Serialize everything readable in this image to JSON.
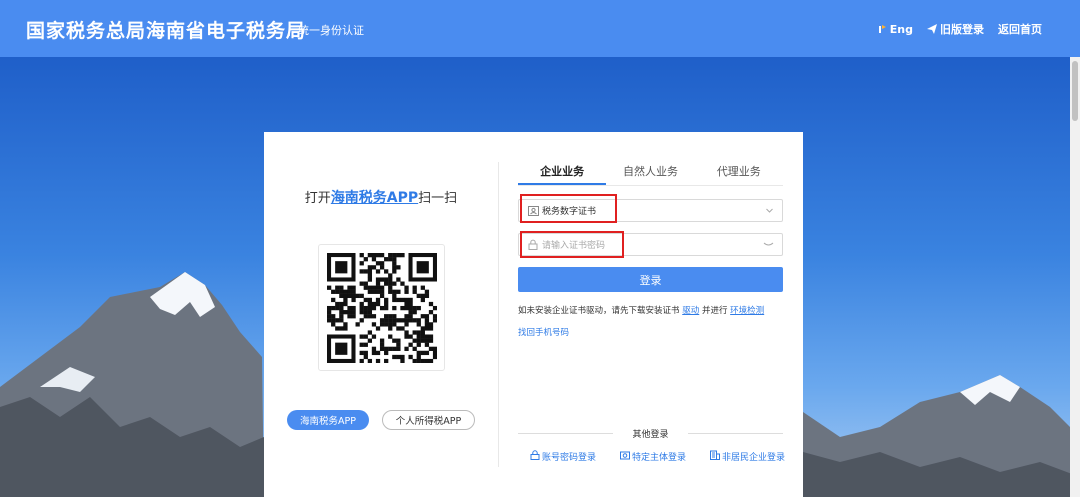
{
  "header": {
    "title": "国家税务总局海南省电子税务局",
    "subtitle": "统一身份认证",
    "nav": {
      "eng": "Eng",
      "old_login": "旧版登录",
      "home": "返回首页"
    }
  },
  "left_panel": {
    "scan_prefix": "打开",
    "app_name": "海南税务APP",
    "scan_suffix": "扫一扫",
    "buttons": {
      "hainan_app": "海南税务APP",
      "personal_tax_app": "个人所得税APP"
    }
  },
  "tabs": [
    {
      "label": "企业业务",
      "active": true
    },
    {
      "label": "自然人业务",
      "active": false
    },
    {
      "label": "代理业务",
      "active": false
    }
  ],
  "form": {
    "cert_select": "税务数字证书",
    "password_placeholder": "请输入证书密码",
    "login_button": "登录",
    "hint_text": "如未安装企业证书驱动，请先下载安装证书",
    "driver_link": "驱动",
    "hint_mid": "并进行",
    "env_check_link": "环境检测",
    "find_phone_link": "找回手机号码"
  },
  "other_login": {
    "title": "其他登录",
    "options": {
      "account": "账号密码登录",
      "specific": "特定主体登录",
      "nonresident": "非居民企业登录"
    }
  },
  "colors": {
    "header": "#4a8cf0",
    "accent": "#2f7be6",
    "highlight": "#e02020"
  }
}
